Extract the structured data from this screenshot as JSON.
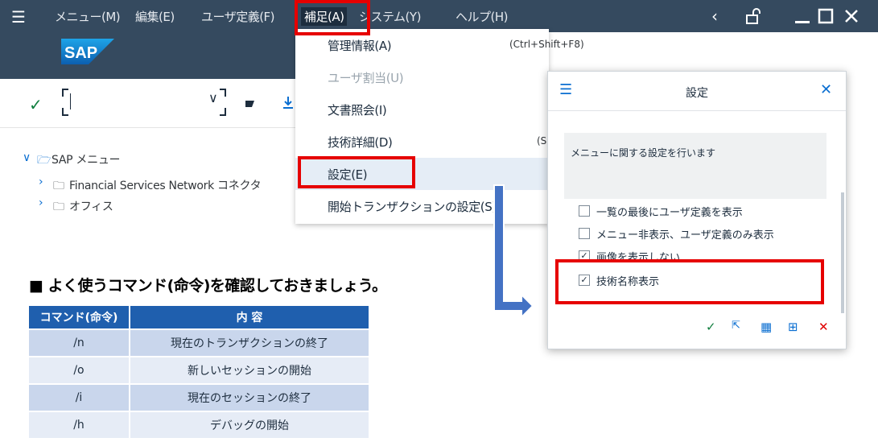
{
  "menubar": {
    "items": [
      "メニュー(M)",
      "編集(E)",
      "ユーザ定義(F)",
      "補足(A)",
      "システム(Y)",
      "ヘルプ(H)"
    ],
    "active_index": 3
  },
  "logo": {
    "text": "SAP"
  },
  "toolbar": {
    "command_value": ""
  },
  "tree": {
    "root": "SAP メニュー",
    "children": [
      "Financial Services Network コネクタ",
      "オフィス"
    ]
  },
  "dropdown": {
    "items": [
      {
        "label": "管理情報(A)",
        "shortcut": "(Ctrl+Shift+F8)",
        "disabled": false
      },
      {
        "label": "ユーザ割当(U)",
        "shortcut": "",
        "disabled": true
      },
      {
        "label": "文書照会(I)",
        "shortcut": "",
        "disabled": false
      },
      {
        "label": "技術詳細(D)",
        "shortcut": "(S",
        "disabled": false
      },
      {
        "label": "設定(E)",
        "shortcut": "",
        "disabled": false
      },
      {
        "label": "開始トランザクションの設定(S)",
        "shortcut": "",
        "disabled": false
      }
    ]
  },
  "dialog": {
    "title": "設定",
    "description": "メニューに関する設定を行います",
    "options": [
      {
        "label": "一覧の最後にユーザ定義を表示",
        "checked": false
      },
      {
        "label": "メニュー非表示、ユーザ定義のみ表示",
        "checked": false
      },
      {
        "label": "画像を表示しない",
        "checked": true
      },
      {
        "label": "技術名称表示",
        "checked": true
      }
    ]
  },
  "guide": {
    "heading": "■ よく使うコマンド(命令)を確認しておきましょう。",
    "columns": [
      "コマンド(命令)",
      "内 容"
    ],
    "rows": [
      [
        "/n",
        "現在のトランザクションの終了"
      ],
      [
        "/o",
        "新しいセッションの開始"
      ],
      [
        "/i",
        "現在のセッションの終了"
      ],
      [
        "/h",
        "デバッグの開始"
      ]
    ]
  },
  "colors": {
    "shell": "#354a5f",
    "highlight": "#e60000",
    "table_header": "#1f5fae",
    "arrow": "#4472c4",
    "ok_green": "#107e3e",
    "cancel_red": "#e00000"
  }
}
